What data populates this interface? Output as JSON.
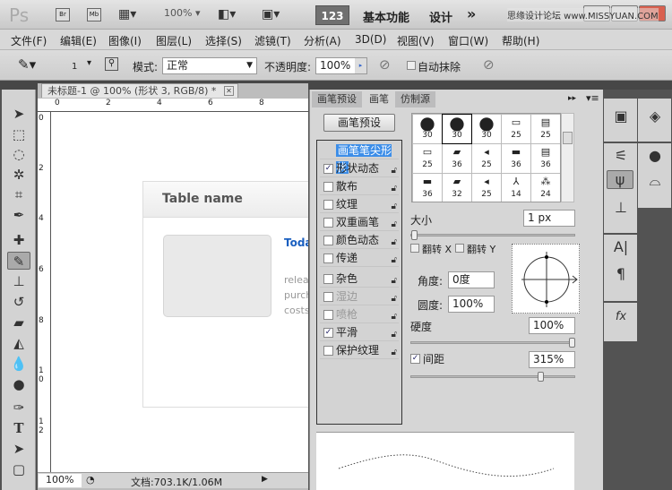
{
  "appbar": {
    "logo": "Ps",
    "bridge": "Br",
    "mini_bridge": "Mb",
    "zoom": "100%",
    "workspace_badge": "123",
    "workspace_main": "基本功能",
    "workspace_design": "设计",
    "more": "»",
    "watermark": "思缘设计论坛 www.MISSYUAN.COM"
  },
  "menu": [
    "文件(F)",
    "编辑(E)",
    "图像(I)",
    "图层(L)",
    "选择(S)",
    "滤镜(T)",
    "分析(A)",
    "3D(D)",
    "视图(V)",
    "窗口(W)",
    "帮助(H)"
  ],
  "options": {
    "brush_size": "1",
    "mode_label": "模式:",
    "mode_value": "正常",
    "opacity_label": "不透明度:",
    "opacity_value": "100%",
    "auto_erase": "自动抹除",
    "auto_erase_checked": false
  },
  "document": {
    "tab_title": "未标题-1 @ 100% (形状 3, RGB/8) *",
    "ruler_top": [
      "0",
      "2",
      "4",
      "6",
      "8"
    ],
    "ruler_left": [
      "0",
      "2",
      "4",
      "6",
      "8",
      "1\n0",
      "1\n2"
    ],
    "zoom": "100%",
    "doc_info": "文档:703.1K/1.06M"
  },
  "canvas": {
    "table_name": "Table name",
    "heading": "Toda",
    "body_lines": [
      "releа",
      "purch",
      "costs"
    ]
  },
  "brush_panel": {
    "tabs": [
      "画笔预设",
      "画笔",
      "仿制源"
    ],
    "active_tab": 1,
    "preset_button": "画笔预设",
    "options": [
      {
        "label": "画笔笔尖形状",
        "checked": null,
        "selected": true
      },
      {
        "label": "形状动态",
        "checked": true
      },
      {
        "label": "散布",
        "checked": false
      },
      {
        "label": "纹理",
        "checked": false
      },
      {
        "label": "双重画笔",
        "checked": false
      },
      {
        "label": "颜色动态",
        "checked": false
      },
      {
        "label": "传递",
        "checked": false
      },
      {
        "label": "杂色",
        "checked": false
      },
      {
        "label": "湿边",
        "checked": false,
        "disabled": true
      },
      {
        "label": "喷枪",
        "checked": false,
        "disabled": true
      },
      {
        "label": "平滑",
        "checked": true
      },
      {
        "label": "保护纹理",
        "checked": false
      }
    ],
    "tips": [
      "30",
      "30",
      "30",
      "25",
      "25",
      "25",
      "36",
      "25",
      "36",
      "36",
      "36",
      "32",
      "25",
      "14",
      "24"
    ],
    "selected_tip": 1,
    "size_label": "大小",
    "size_value": "1 px",
    "size_percent": 0,
    "flip_x": "翻转 X",
    "flip_y": "翻转 Y",
    "angle_label": "角度:",
    "angle_value": "0度",
    "roundness_label": "圆度:",
    "roundness_value": "100%",
    "hardness_label": "硬度",
    "hardness_value": "100%",
    "hardness_percent": 100,
    "spacing_label": "间距",
    "spacing_checked": true,
    "spacing_value": "315%",
    "spacing_percent": 80
  }
}
